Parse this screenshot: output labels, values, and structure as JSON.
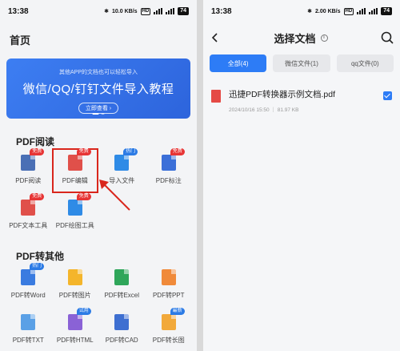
{
  "left": {
    "status": {
      "time": "13:38",
      "speed": "10.0 KB/s",
      "battery": "74"
    },
    "page_title": "首页",
    "banner": {
      "subtitle": "其他APP的文档也可以轻松导入",
      "title": "微信/QQ/钉钉文件导入教程",
      "button": "立即查看 ›"
    },
    "sections": [
      {
        "title": "PDF阅读",
        "tools": [
          {
            "label": "PDF阅读",
            "badge": "免费",
            "badge_color": "red",
            "icon_color": "#4a6fb5",
            "icon": "book-icon"
          },
          {
            "label": "PDF编辑",
            "badge": "免费",
            "badge_color": "red",
            "icon_color": "#e0504a",
            "icon": "edit-pdf-icon",
            "highlight": true
          },
          {
            "label": "导入文件",
            "badge": "热门",
            "badge_color": "blue",
            "icon_color": "#2f8be6",
            "icon": "import-icon"
          },
          {
            "label": "PDF标注",
            "badge": "免费",
            "badge_color": "red",
            "icon_color": "#3b6fd8",
            "icon": "annotate-icon"
          },
          {
            "label": "PDF文本工具",
            "badge": "免费",
            "badge_color": "red",
            "icon_color": "#e0504a",
            "icon": "text-tool-icon"
          },
          {
            "label": "PDF绘图工具",
            "badge": "免费",
            "badge_color": "red",
            "icon_color": "#2f8be6",
            "icon": "draw-tool-icon"
          }
        ]
      },
      {
        "title": "PDF转其他",
        "tools": [
          {
            "label": "PDF转Word",
            "badge": "热门",
            "badge_color": "blue",
            "icon_color": "#3a7be0",
            "icon": "word-icon"
          },
          {
            "label": "PDF转图片",
            "badge": "",
            "badge_color": "",
            "icon_color": "#f4b52b",
            "icon": "image-icon"
          },
          {
            "label": "PDF转Excel",
            "badge": "",
            "badge_color": "",
            "icon_color": "#2fa65a",
            "icon": "excel-icon"
          },
          {
            "label": "PDF转PPT",
            "badge": "",
            "badge_color": "",
            "icon_color": "#f08a3a",
            "icon": "ppt-icon"
          },
          {
            "label": "PDF转TXT",
            "badge": "",
            "badge_color": "",
            "icon_color": "#5aa0e6",
            "icon": "txt-icon"
          },
          {
            "label": "PDF转HTML",
            "badge": "试用",
            "badge_color": "blue",
            "icon_color": "#8a62d6",
            "icon": "html-icon"
          },
          {
            "label": "PDF转CAD",
            "badge": "",
            "badge_color": "",
            "icon_color": "#3e6fd1",
            "icon": "cad-icon"
          },
          {
            "label": "PDF转长图",
            "badge": "最新",
            "badge_color": "blue",
            "icon_color": "#f2a93a",
            "icon": "long-image-icon"
          }
        ]
      }
    ]
  },
  "right": {
    "status": {
      "time": "13:38",
      "speed": "2.00 KB/s",
      "battery": "74"
    },
    "title": "选择文档",
    "tabs": [
      "全部(4)",
      "微信文件(1)",
      "qq文件(0)"
    ],
    "active_tab": 0,
    "files": [
      {
        "name": "迅捷PDF转换器示例文档.pdf",
        "meta": "2024/10/16 15:50 ｜ 81.97 KB",
        "checked": true
      }
    ]
  },
  "colors": {
    "accent": "#2d7cf6",
    "highlight": "#d9261c",
    "badge_red": "#e73535"
  }
}
